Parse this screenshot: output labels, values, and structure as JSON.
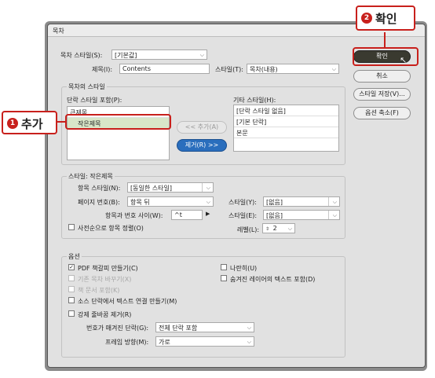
{
  "window": {
    "title": "목차"
  },
  "top": {
    "toc_style_label": "목차 스타일(S):",
    "toc_style_value": "[기본값]",
    "title_label": "제목(I):",
    "title_value": "Contents",
    "style_label": "스타일(T):",
    "style_value": "목차(내용)"
  },
  "buttons": {
    "ok": "확인",
    "cancel": "취소",
    "save_style": "스타일 저장(V)...",
    "fewer_options": "옵션 축소(F)",
    "add": "<< 추가(A)",
    "remove": "제거(R) >>"
  },
  "toc_styles": {
    "group_title": "목차의 스타일",
    "include_label": "단락 스타일 포함(P):",
    "include_items": [
      "큰제목",
      "작은제목"
    ],
    "other_label": "기타 스타일(H):",
    "other_items": [
      "[단락 스타일 없음]",
      "[기본 단락]",
      "본문"
    ]
  },
  "style_section": {
    "group_title": "스타일: 작은제목",
    "entry_style_label": "항목 스타일(N):",
    "entry_style_value": "[동일한 스타일]",
    "page_number_label": "페이지 번호(B):",
    "page_number_value": "항목 뒤",
    "page_number_style_label": "스타일(Y):",
    "page_number_style_value": "[없음]",
    "between_label": "항목과 번호 사이(W):",
    "between_value": "^t",
    "between_style_label": "스타일(E):",
    "between_style_value": "[없음]",
    "sort_label": "사전순으로 항목 정렬(O)",
    "level_label": "레벨(L):",
    "level_value": "2"
  },
  "options": {
    "group_title": "옵션",
    "pdf_bookmarks": "PDF 책갈피 만들기(C)",
    "pdf_bookmarks_checked": "✓",
    "replace_toc": "기존 목차 바꾸기(X)",
    "include_book": "책 문서 포함(K)",
    "source_links": "소스 단락에서 텍스트 연결 만들기(M)",
    "remove_breaks": "강제 줄바꿈 제거(R)",
    "run_in": "나란히(U)",
    "hidden_layers": "숨겨진 레이어의 텍스트 포함(D)",
    "numbered_label": "번호가 매겨진 단락(G):",
    "numbered_value": "전체 단락 포함",
    "frame_direction_label": "프레임 방향(M):",
    "frame_direction_value": "가로"
  },
  "callouts": {
    "add_num": "1",
    "add_text": "추가",
    "ok_num": "2",
    "ok_text": "확인"
  },
  "colors": {
    "callout": "#c8201c",
    "primary_button": "#3a3a30",
    "remove_button": "#2a6ebd",
    "highlight": "#d8e6c8"
  }
}
